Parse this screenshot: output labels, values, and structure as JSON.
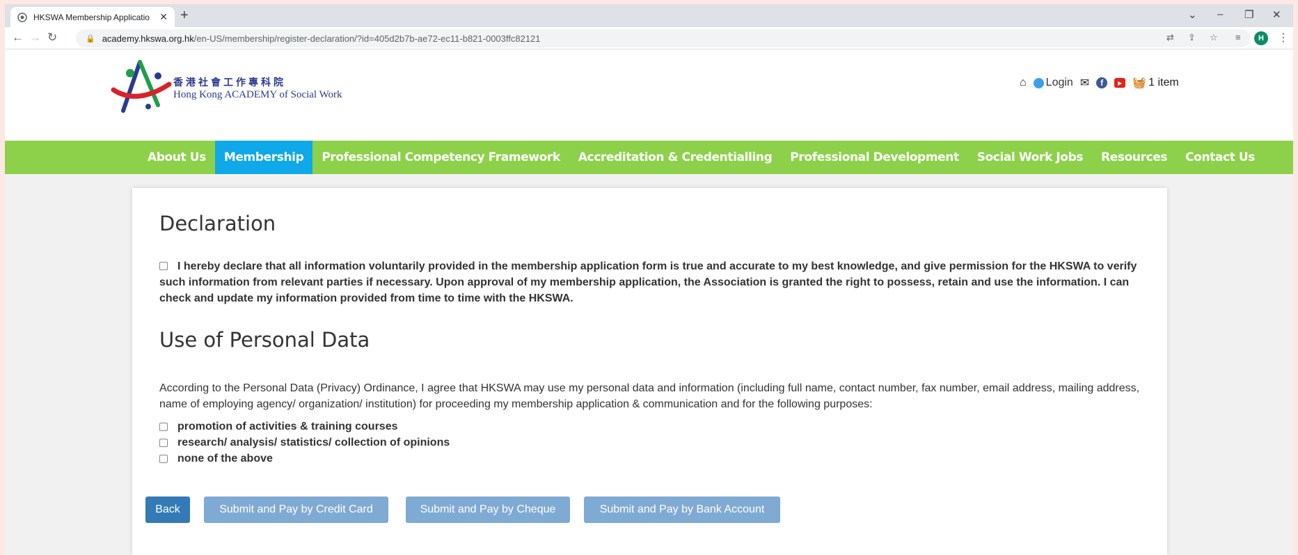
{
  "browser": {
    "tab_title": "HKSWA Membership Applicatio",
    "url_host": "academy.hkswa.org.hk",
    "url_path": "/en-US/membership/register-declaration/?id=405d2b7b-ae72-ec11-b821-0003ffc82121",
    "profile_initial": "H"
  },
  "logo": {
    "chinese": "香港社會工作專科院",
    "english": "Hong Kong ACADEMY of Social Work"
  },
  "header": {
    "login_label": "Login",
    "cart_label": "1 item"
  },
  "nav": {
    "items": [
      {
        "label": "About Us"
      },
      {
        "label": "Membership"
      },
      {
        "label": "Professional Competency Framework"
      },
      {
        "label": "Accreditation & Credentialling"
      },
      {
        "label": "Professional Development"
      },
      {
        "label": "Social Work Jobs"
      },
      {
        "label": "Resources"
      },
      {
        "label": "Contact Us"
      }
    ],
    "active_index": 1
  },
  "declaration": {
    "heading": "Declaration",
    "text": "I hereby declare that all information voluntarily provided in the membership application form is true and accurate to my best knowledge, and give permission for the HKSWA to verify such information from relevant parties if necessary. Upon approval of my membership application, the Association is granted the right to possess, retain and use the information. I can check and update my information provided from time to time with the HKSWA."
  },
  "personal_data": {
    "heading": "Use of Personal Data",
    "text": "According to the Personal Data (Privacy) Ordinance, I agree that HKSWA may use my personal data and information (including full name, contact number, fax number, email address, mailing address, name of employing agency/ organization/ institution) for proceeding my membership application & communication and for the following purposes:",
    "options": [
      {
        "label": "promotion of activities & training courses"
      },
      {
        "label": "research/ analysis/ statistics/ collection of opinions"
      },
      {
        "label": "none of the above"
      }
    ]
  },
  "buttons": {
    "back": "Back",
    "credit_card": "Submit and Pay by Credit Card",
    "cheque": "Submit and Pay by Cheque",
    "bank_account": "Submit and Pay by Bank Account"
  },
  "colors": {
    "nav_green": "#8dd14a",
    "nav_active_blue": "#0fa8e8",
    "button_primary": "#337ab7",
    "button_muted": "#7faad3"
  }
}
